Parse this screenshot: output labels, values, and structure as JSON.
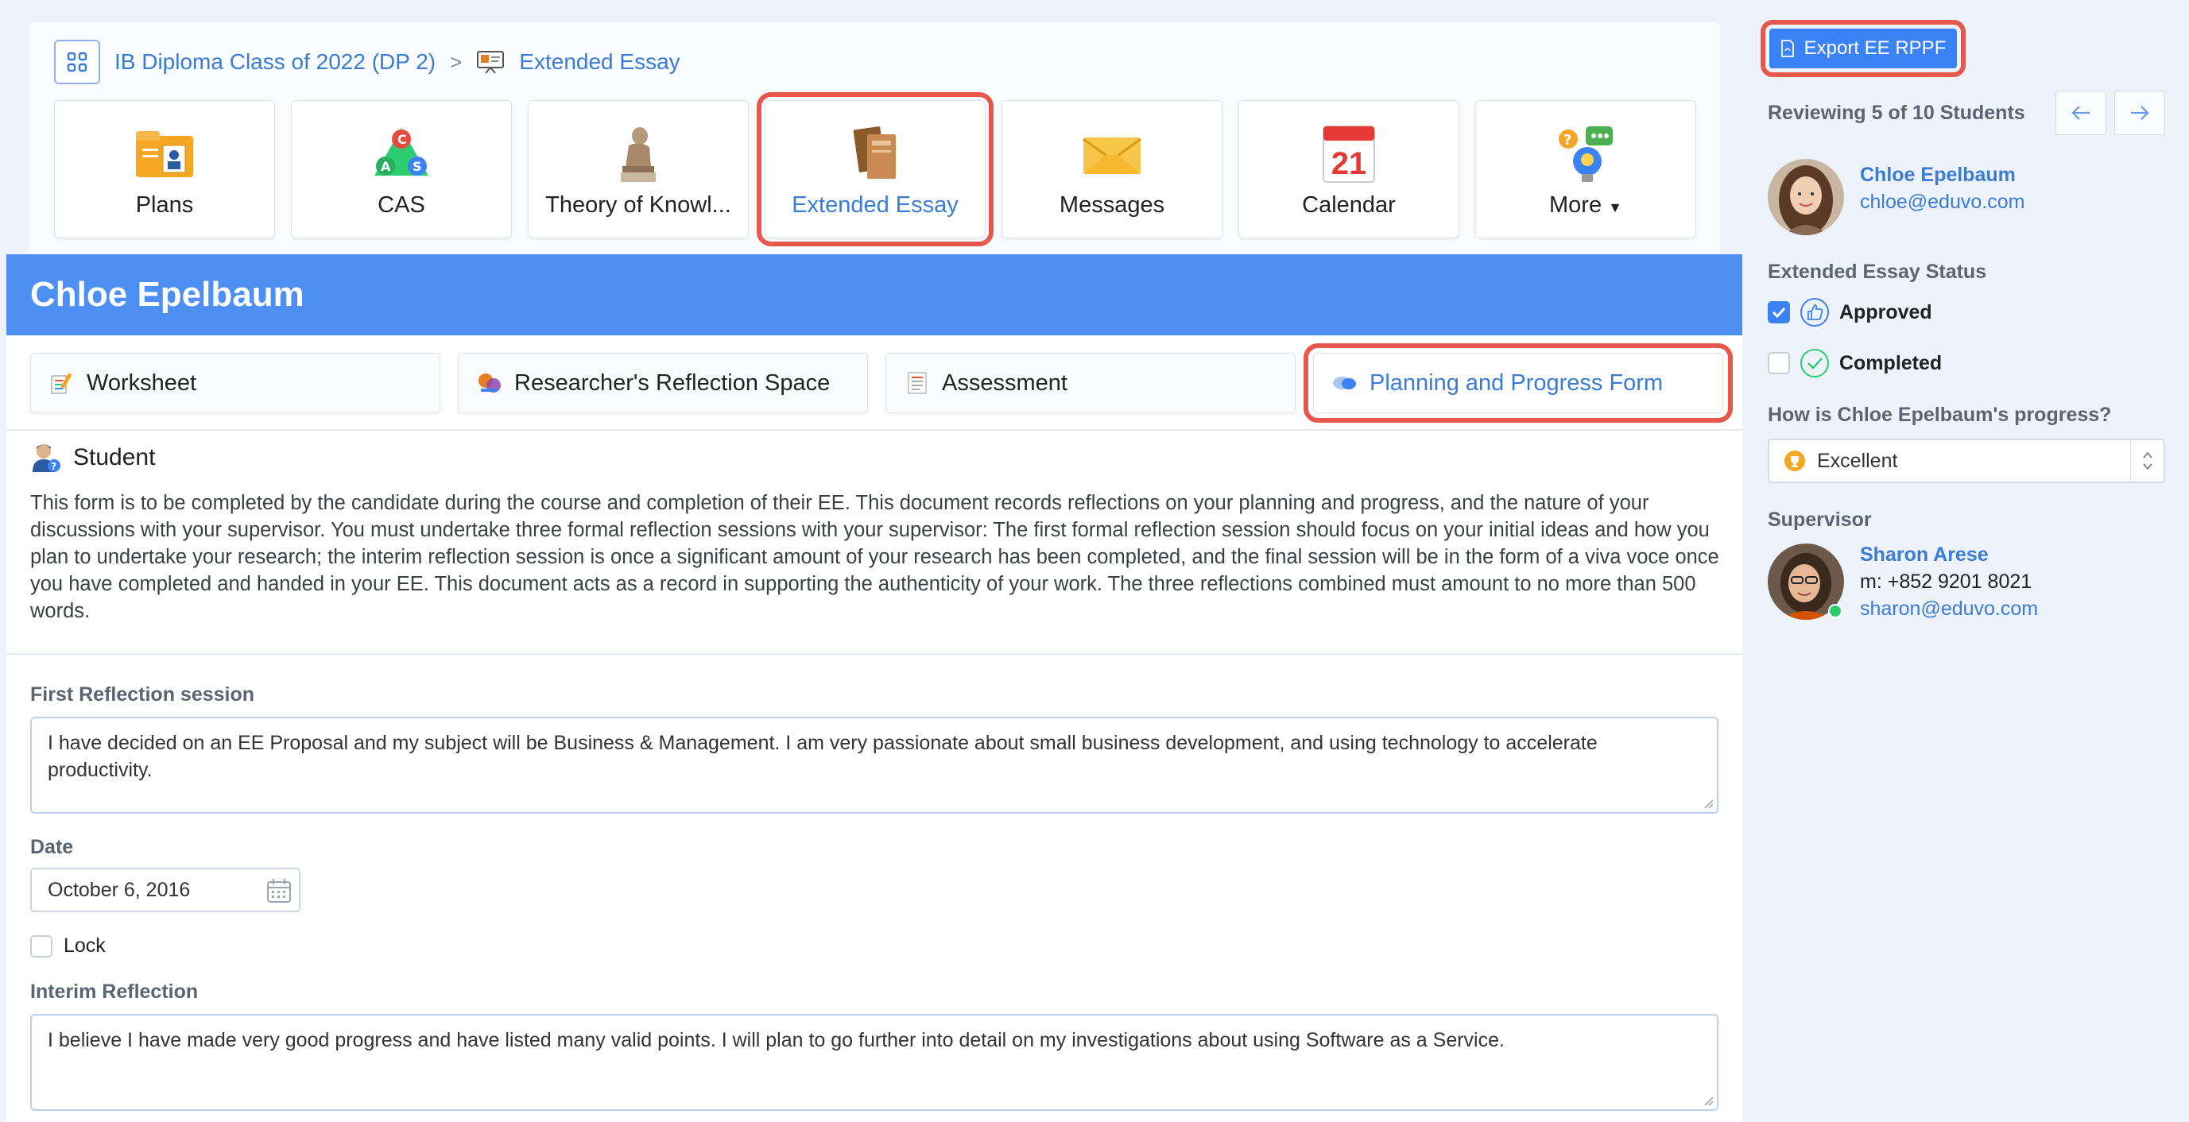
{
  "breadcrumb": {
    "class_name": "IB Diploma Class of 2022 (DP 2)",
    "separator": ">",
    "section": "Extended Essay"
  },
  "tiles": [
    {
      "label": "Plans",
      "icon": "plans-icon"
    },
    {
      "label": "CAS",
      "icon": "cas-icon"
    },
    {
      "label": "Theory of Knowl...",
      "icon": "thinker-icon"
    },
    {
      "label": "Extended Essay",
      "icon": "books-icon",
      "active": true
    },
    {
      "label": "Messages",
      "icon": "envelope-icon"
    },
    {
      "label": "Calendar",
      "icon": "calendar-icon",
      "calendar_day": "21"
    },
    {
      "label": "More",
      "icon": "more-icon"
    }
  ],
  "banner": {
    "student_name": "Chloe Epelbaum"
  },
  "subtabs": [
    {
      "label": "Worksheet",
      "icon": "worksheet-icon"
    },
    {
      "label": "Researcher's Reflection Space",
      "icon": "reflection-icon"
    },
    {
      "label": "Assessment",
      "icon": "assessment-icon"
    },
    {
      "label": "Planning and Progress Form",
      "icon": "planning-icon",
      "active": true
    }
  ],
  "student_section": {
    "heading": "Student",
    "description": "This form is to be completed by the candidate during the course and completion of their EE. This document records reflections on your planning and progress, and the nature of your discussions with your supervisor. You must undertake three formal reflection sessions with your supervisor: The first formal reflection session should focus on your initial ideas and how you plan to undertake your research; the interim reflection session is once a significant amount of your research has been completed, and the final session will be in the form of a viva voce once you have completed and handed in your EE. This document acts as a record in supporting the authenticity of your work. The three reflections combined must amount to no more than 500 words."
  },
  "form": {
    "first_label": "First Reflection session",
    "first_value": "I have decided on an EE Proposal and my subject will be Business & Management. I am very passionate about small business development, and using technology to accelerate productivity.",
    "date_label": "Date",
    "date_value": "October 6, 2016",
    "lock_label": "Lock",
    "interim_label": "Interim Reflection",
    "interim_value": "I believe I have made very good progress and have listed many valid points. I will plan to go further into detail on my investigations about using Software as a Service."
  },
  "sidebar": {
    "export_label": "Export EE RPPF",
    "reviewing": "Reviewing 5 of 10 Students",
    "student": {
      "name": "Chloe Epelbaum",
      "email": "chloe@eduvo.com"
    },
    "status_label": "Extended Essay Status",
    "approved_label": "Approved",
    "approved_checked": true,
    "completed_label": "Completed",
    "completed_checked": false,
    "progress_question": "How is Chloe Epelbaum's progress?",
    "progress_value": "Excellent",
    "supervisor_label": "Supervisor",
    "supervisor": {
      "name": "Sharon Arese",
      "phone": "m: +852 9201 8021",
      "email": "sharon@eduvo.com"
    }
  },
  "colors": {
    "accent": "#3b82f6",
    "banner": "#4d8ff2",
    "highlight": "#e8574b",
    "online": "#2ecc71"
  }
}
